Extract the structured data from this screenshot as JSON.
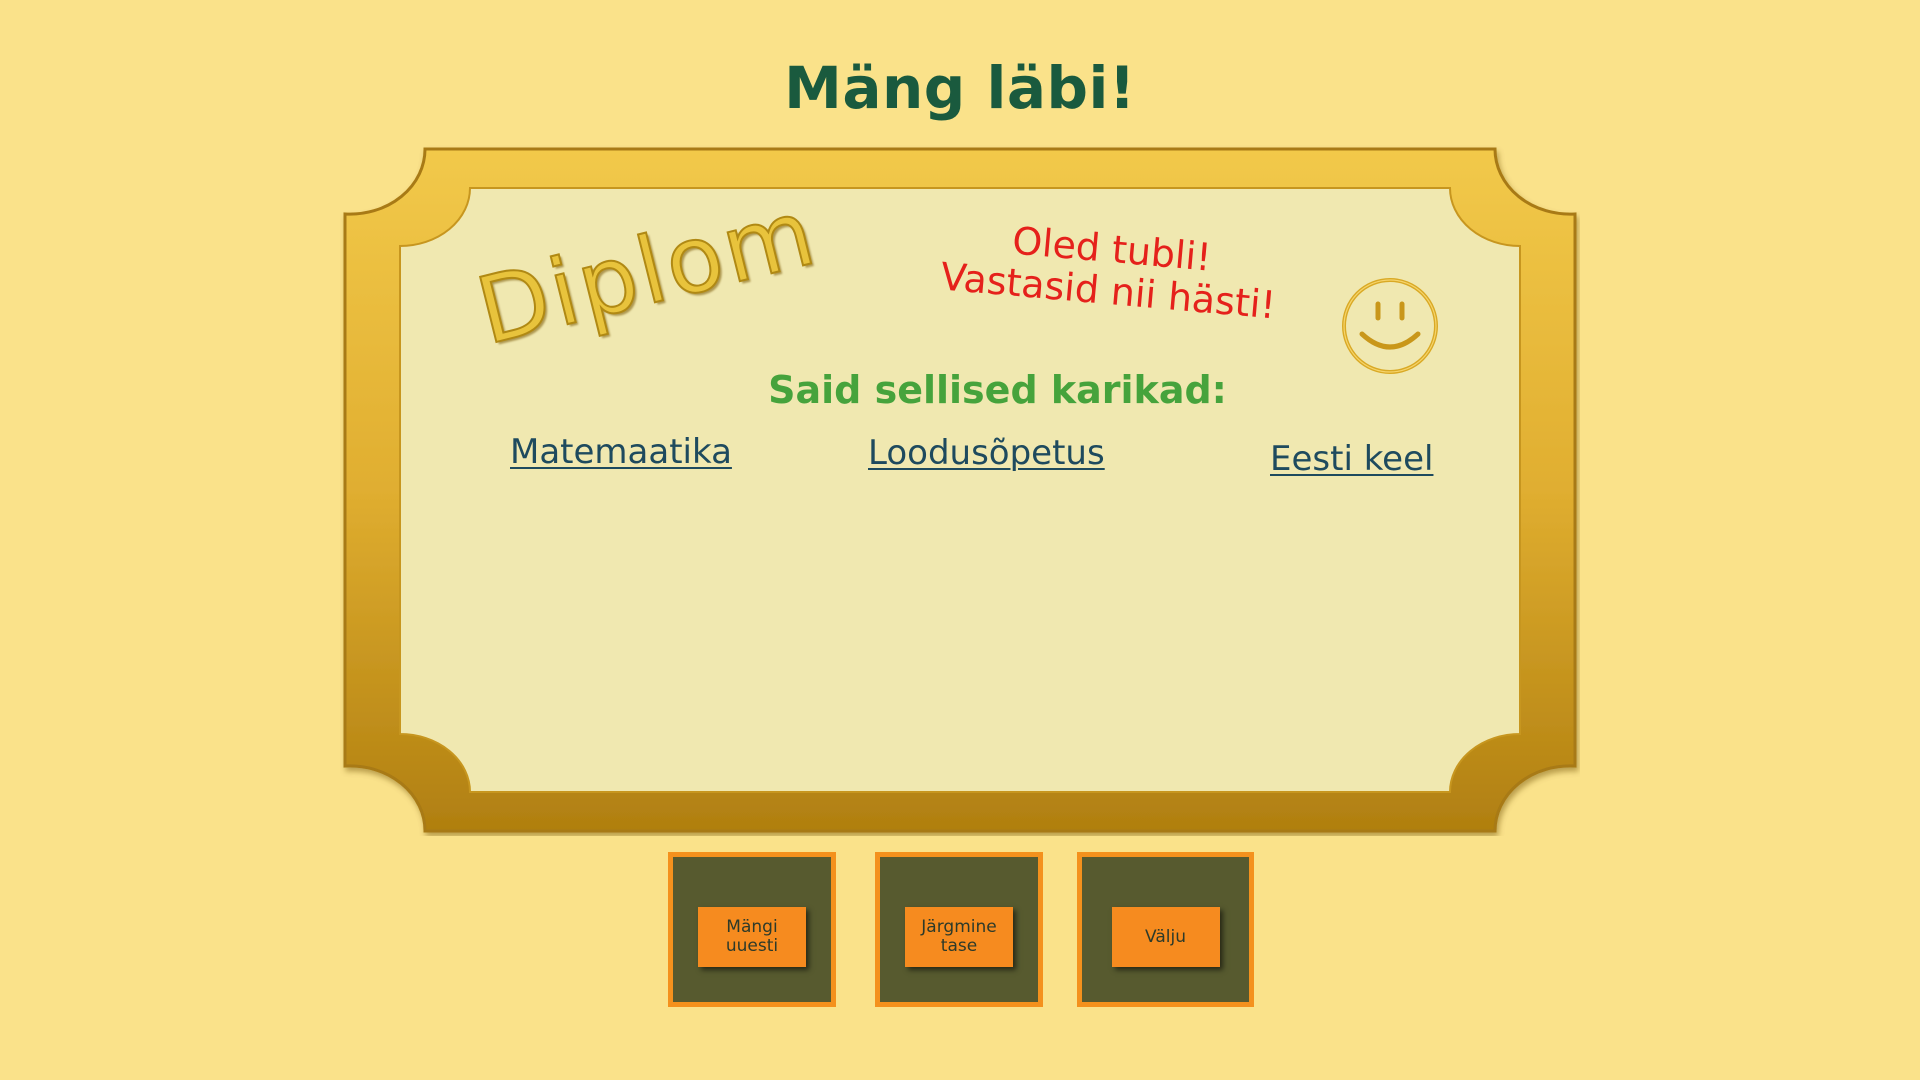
{
  "title": "Mäng läbi!",
  "diploma": {
    "heading": "Diplom",
    "praise_line1": "Oled tubli!",
    "praise_line2": "Vastasid nii hästi!",
    "smiley_icon": "smiley-face-icon",
    "trophies_heading": "Said sellised karikad:",
    "subjects": [
      "Matemaatika",
      "Loodusõpetus",
      "Eesti keel"
    ]
  },
  "buttons": {
    "play_again_line1": "Mängi",
    "play_again_line2": "uuesti",
    "next_level_line1": "Järgmine",
    "next_level_line2": "tase",
    "exit": "Välju"
  },
  "colors": {
    "background": "#fae28a",
    "frame_gold": "#e0ae30",
    "diploma_paper": "#f0e8b0",
    "title": "#1a5a3e",
    "praise": "#e5211b",
    "trophies_heading": "#46a33c",
    "subject_link": "#1e4a5e",
    "button_box": "#575a2f",
    "button_orange": "#f68b1f"
  }
}
